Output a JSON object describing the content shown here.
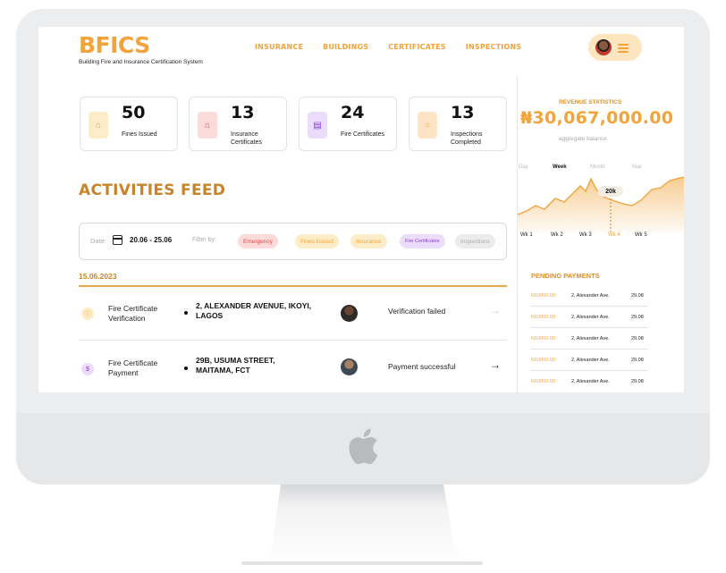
{
  "brand": {
    "logo": "BFICS",
    "tagline": "Building Fire and Insurance Certification System"
  },
  "nav": [
    "INSURANCE",
    "BUILDINGS",
    "CERTIFICATES",
    "INSPECTIONS"
  ],
  "stats": [
    {
      "value": "50",
      "label": "Fines Issued",
      "icon": "home-icon",
      "color": "#fdecc8"
    },
    {
      "value": "13",
      "label": "Insurance Certificates",
      "icon": "home-icon",
      "color": "#fcdada"
    },
    {
      "value": "24",
      "label": "Fire Certificates",
      "icon": "chat-icon",
      "color": "#ecdcfb"
    },
    {
      "value": "13",
      "label": "Inspections Completed",
      "icon": "search-icon",
      "color": "#fde4c4"
    }
  ],
  "feed": {
    "title": "ACTIVITIES FEED",
    "date_label": "Date:",
    "date_range": "20.06 - 25.06",
    "filter_label": "Filter by:",
    "chips": [
      {
        "label": "Emergency",
        "bg": "#fcdada",
        "fg": "#e24848"
      },
      {
        "label": "Fines Issued",
        "bg": "#fdecc8",
        "fg": "#f2a43b"
      },
      {
        "label": "Insurance",
        "bg": "#fdecc8",
        "fg": "#f2a43b"
      },
      {
        "label": "Fire Certificates",
        "bg": "#ecdcfb",
        "fg": "#8a3ad8"
      },
      {
        "label": "Inspections",
        "bg": "#ececec",
        "fg": "#aaa"
      }
    ],
    "date_heading": "15.06.2023",
    "rows": [
      {
        "title": "Fire Certificate Verification",
        "address": "2, ALEXANDER AVENUE, IKOYI, LAGOS",
        "status": "Verification failed",
        "icon": "info-icon",
        "arrow": "→"
      },
      {
        "title": "Fire Certificate Payment",
        "address": "29B, USUMA STREET, MAITAMA, FCT",
        "status": "Payment successful",
        "icon": "dollar-icon",
        "arrow": "→"
      }
    ]
  },
  "revenue": {
    "title": "REVENUE STATISTICS",
    "amount": "₦30,067,000.00",
    "subtitle": "aggregate balance",
    "periods": [
      "Day",
      "Week",
      "Month",
      "Year"
    ],
    "active_period": "Week",
    "weeks": [
      "Wk 1",
      "Wk 2",
      "Wk 3",
      "Wk 4",
      "Wk 5"
    ],
    "highlight": "20k",
    "accent": "#f2a43b"
  },
  "pending": {
    "title": "PENDING PAYMENTS",
    "rows": [
      {
        "amount": "N10000.00",
        "desc": "2, Alexander Ave.",
        "date": "29.08"
      },
      {
        "amount": "N10000.00",
        "desc": "2, Alexander Ave.",
        "date": "29.08"
      },
      {
        "amount": "N10000.00",
        "desc": "2, Alexander Ave.",
        "date": "29.08"
      },
      {
        "amount": "N10000.00",
        "desc": "2, Alexander Ave.",
        "date": "29.08"
      },
      {
        "amount": "N10000.00",
        "desc": "2, Alexander Ave.",
        "date": "29.08"
      }
    ]
  }
}
